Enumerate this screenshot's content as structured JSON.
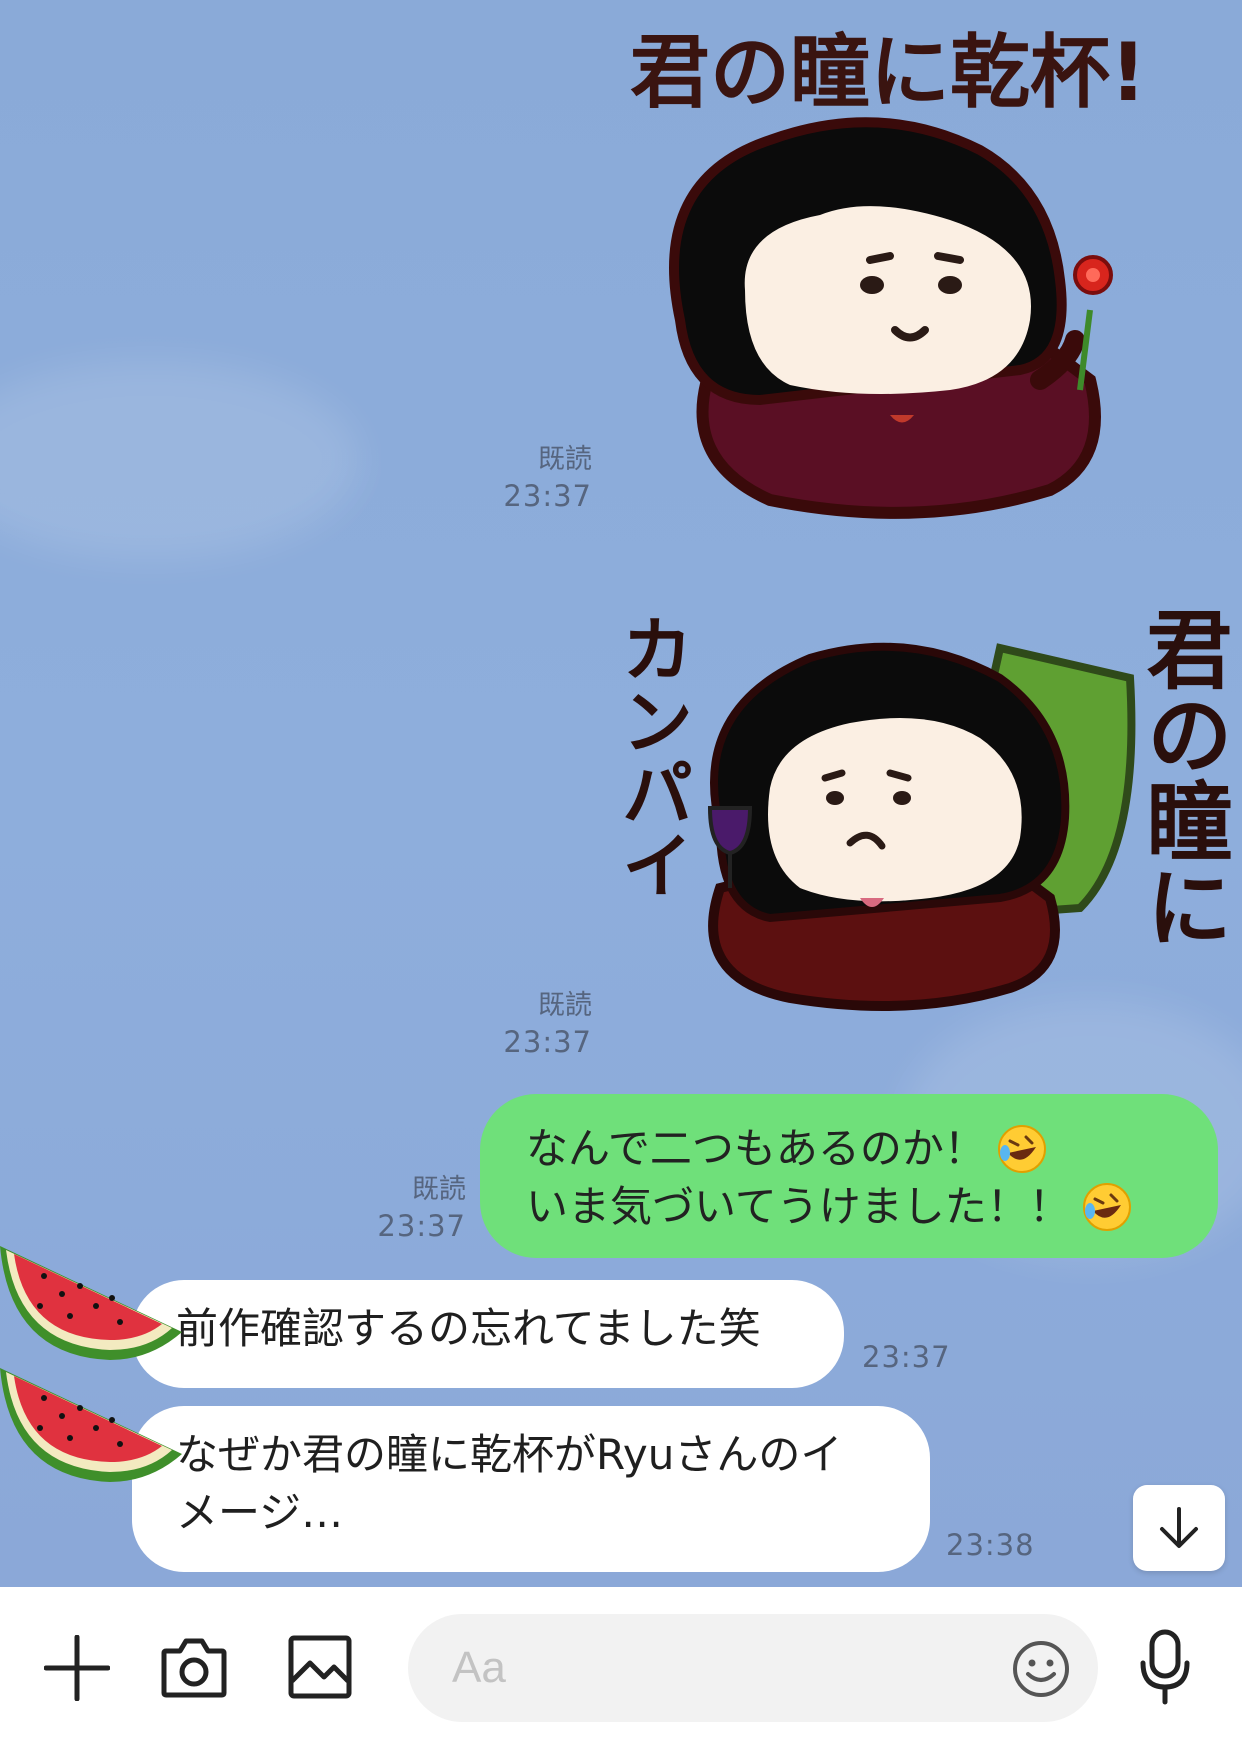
{
  "stickers": [
    {
      "caption": "君の瞳に乾杯!",
      "read_label": "既読",
      "time": "23:37"
    },
    {
      "caption_left": "カンパイ",
      "caption_right": "君の瞳に",
      "read_label": "既読",
      "time": "23:37"
    }
  ],
  "sent_message": {
    "line1": "なんで二つもあるのか！",
    "line2": "いま気づいてうけました！！",
    "read_label": "既読",
    "time": "23:37"
  },
  "received_messages": [
    {
      "text": "前作確認するの忘れてました笑",
      "time": "23:37"
    },
    {
      "line1": "なぜか君の瞳に乾杯がRyuさんのイ",
      "line2": "メージ…",
      "time": "23:38"
    }
  ],
  "input": {
    "placeholder": "Aa"
  },
  "icons": {
    "plus": "plus-icon",
    "camera": "camera-icon",
    "image": "image-icon",
    "emoji": "smiley-icon",
    "mic": "microphone-icon",
    "scroll": "arrow-down-icon"
  },
  "colors": {
    "chat_background": "#8eaedc",
    "sent_bubble": "#6fe07a",
    "received_bubble": "#ffffff"
  }
}
